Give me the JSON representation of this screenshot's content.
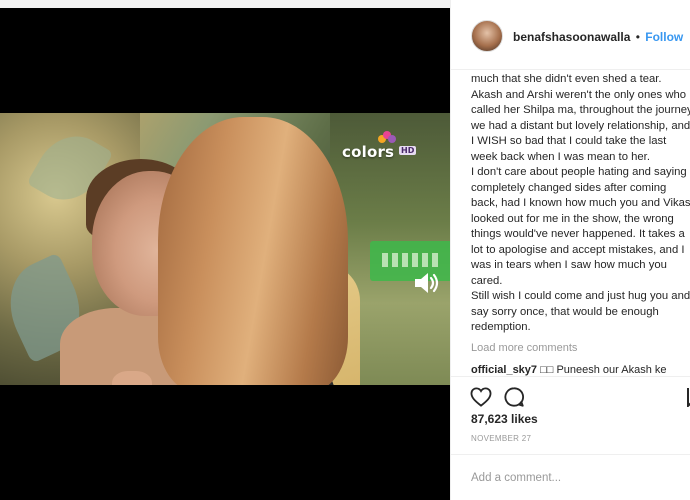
{
  "post": {
    "username": "benafshasoonawalla",
    "separator": "•",
    "follow_label": "Follow",
    "caption_lines": [
      "much that she didn't even shed a tear.",
      "Akash and Arshi weren't the only ones who called her Shilpa ma, throughout the journey we had a distant but lovely relationship, and I WISH so bad that I could take the last week back when I was mean to her.",
      "I don't care about people hating and saying I completely changed sides after coming back, had I known how much you and Vikas looked out for me in the show, the wrong things would've never happened. It takes a lot to apologise and accept mistakes, and I was in tears when I saw how much you cared.",
      "Still wish I could come and just hug you and say sorry once, that would be enough redemption."
    ],
    "load_more_label": "Load more comments",
    "comment": {
      "user": "official_sky7",
      "text": " □□ Puneesh our Akash ke"
    },
    "likes": "87,623 likes",
    "date": "NOVEMBER 27",
    "add_comment_placeholder": "Add a comment..."
  },
  "media": {
    "channel_name": "colors",
    "channel_badge": "HD"
  },
  "icons": {
    "heart": "heart-icon",
    "comment": "comment-icon",
    "save": "bookmark-icon",
    "volume": "volume-icon"
  },
  "colors": {
    "follow": "#3897f0",
    "text": "#262626",
    "muted": "#999999",
    "border": "#efefef"
  }
}
